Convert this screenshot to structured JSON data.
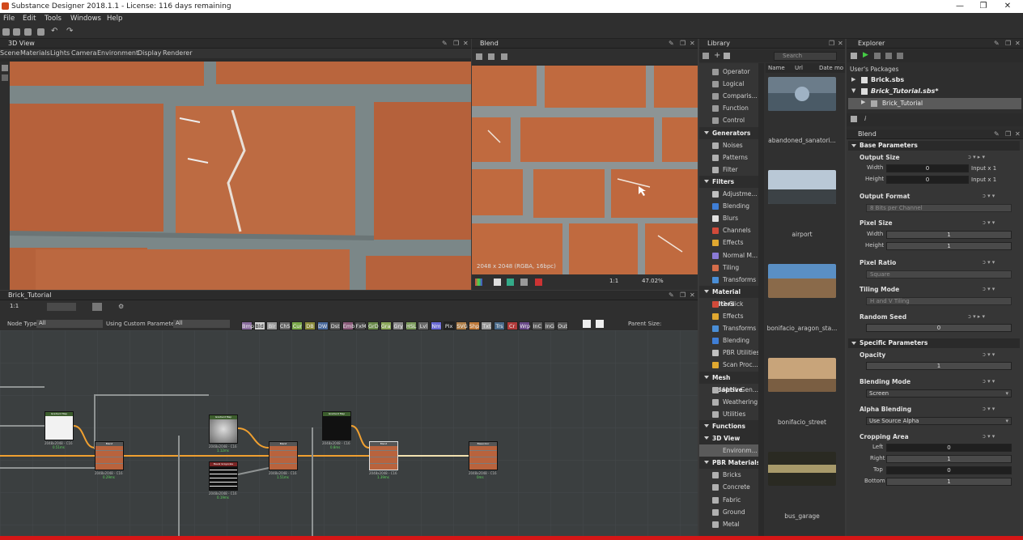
{
  "window": {
    "title": "Substance Designer 2018.1.1 - License: 116 days remaining",
    "min": "—",
    "max": "❐",
    "close": "✕"
  },
  "menu": [
    "File",
    "Edit",
    "Tools",
    "Windows",
    "Help"
  ],
  "view3d": {
    "title": "3D View",
    "menu": [
      "Scene",
      "Materials",
      "Lights",
      "Camera",
      "Environment",
      "Display",
      "Renderer"
    ]
  },
  "view2d": {
    "title": "Blend",
    "overlay": "2048 x 2048 (RGBA, 16bpc)",
    "ratio": "1:1",
    "zoom": "47.02%"
  },
  "library": {
    "title": "Library",
    "search_placeholder": "Search",
    "columns": [
      "Name",
      "Url",
      "Date mo"
    ],
    "items": [
      {
        "type": "item",
        "label": "Operator",
        "color": "#9a9a9a"
      },
      {
        "type": "item",
        "label": "Logical",
        "color": "#9a9a9a"
      },
      {
        "type": "item",
        "label": "Comparis...",
        "color": "#9a9a9a"
      },
      {
        "type": "item",
        "label": "Function",
        "color": "#9a9a9a"
      },
      {
        "type": "item",
        "label": "Control",
        "color": "#9a9a9a"
      },
      {
        "type": "cat",
        "label": "Generators"
      },
      {
        "type": "item",
        "label": "Noises",
        "color": "#b0b0b0"
      },
      {
        "type": "item",
        "label": "Patterns",
        "color": "#b0b0b0"
      },
      {
        "type": "item",
        "label": "Filter",
        "color": "#b0b0b0"
      },
      {
        "type": "cat",
        "label": "Filters"
      },
      {
        "type": "item",
        "label": "Adjustme...",
        "color": "#c0c0c0"
      },
      {
        "type": "item",
        "label": "Blending",
        "color": "#3f7ed6"
      },
      {
        "type": "item",
        "label": "Blurs",
        "color": "#e0e0e0"
      },
      {
        "type": "item",
        "label": "Channels",
        "color": "#d14a3a"
      },
      {
        "type": "item",
        "label": "Effects",
        "color": "#e0a830"
      },
      {
        "type": "item",
        "label": "Normal M...",
        "color": "#8a7ad6"
      },
      {
        "type": "item",
        "label": "Tiling",
        "color": "#d46d4a"
      },
      {
        "type": "item",
        "label": "Transforms",
        "color": "#4a8ed6"
      },
      {
        "type": "cat",
        "label": "Material Filters"
      },
      {
        "type": "item",
        "label": "1-Click",
        "color": "#d14a3a"
      },
      {
        "type": "item",
        "label": "Effects",
        "color": "#e0a830"
      },
      {
        "type": "item",
        "label": "Transforms",
        "color": "#4a8ed6"
      },
      {
        "type": "item",
        "label": "Blending",
        "color": "#3f7ed6"
      },
      {
        "type": "item",
        "label": "PBR Utilities",
        "color": "#c0c0c0"
      },
      {
        "type": "item",
        "label": "Scan Proc...",
        "color": "#e0a830"
      },
      {
        "type": "cat",
        "label": "Mesh Adaptive"
      },
      {
        "type": "item",
        "label": "Mask Gen...",
        "color": "#b0b0b0"
      },
      {
        "type": "item",
        "label": "Weathering",
        "color": "#b0b0b0"
      },
      {
        "type": "item",
        "label": "Utilities",
        "color": "#b0b0b0"
      },
      {
        "type": "cat",
        "label": "Functions"
      },
      {
        "type": "cat",
        "label": "3D View"
      },
      {
        "type": "sel",
        "label": "Environm..."
      },
      {
        "type": "cat",
        "label": "PBR Materials"
      },
      {
        "type": "item",
        "label": "Bricks",
        "color": "#b0b0b0"
      },
      {
        "type": "item",
        "label": "Concrete",
        "color": "#b0b0b0"
      },
      {
        "type": "item",
        "label": "Fabric",
        "color": "#b0b0b0"
      },
      {
        "type": "item",
        "label": "Ground",
        "color": "#b0b0b0"
      },
      {
        "type": "item",
        "label": "Metal",
        "color": "#b0b0b0"
      }
    ],
    "thumbs": [
      "abandoned_sanatori...",
      "airport",
      "bonifacio_aragon_sta...",
      "bonifacio_street",
      "bus_garage"
    ]
  },
  "explorer": {
    "title": "Explorer",
    "user_packages": "User's Packages",
    "packages": [
      "Brick.sbs",
      "Brick_Tutorial.sbs*"
    ],
    "graph": "Brick_Tutorial"
  },
  "graph": {
    "title": "Brick_Tutorial",
    "ratio": "1:1",
    "node_type_label": "Node Type",
    "node_type_value": "All",
    "custom_params_label": "Using Custom Parameters",
    "custom_params_value": "All",
    "parent_size_label": "Parent Size:",
    "chips": [
      {
        "label": "Bmp",
        "color": "#8a6d9e"
      },
      {
        "label": "Bld",
        "color": "#cfcfcf"
      },
      {
        "label": "Blr",
        "color": "#9a9a9a"
      },
      {
        "label": "ChS",
        "color": "#6a6a6a"
      },
      {
        "label": "Cur",
        "color": "#7aa84a"
      },
      {
        "label": "DB",
        "color": "#8a8a3a"
      },
      {
        "label": "DW",
        "color": "#4a6a9e"
      },
      {
        "label": "Dst",
        "color": "#5a5a5a"
      },
      {
        "label": "Emb",
        "color": "#8a5a7a"
      },
      {
        "label": "FxM",
        "color": "#4a4a4a"
      },
      {
        "label": "GrD",
        "color": "#6a8a4a"
      },
      {
        "label": "Gra",
        "color": "#8aa85a"
      },
      {
        "label": "Gry",
        "color": "#8a8a8a"
      },
      {
        "label": "HSL",
        "color": "#7a9a5a"
      },
      {
        "label": "Lvl",
        "color": "#6a6a6a"
      },
      {
        "label": "Nm",
        "color": "#6a6ad6"
      },
      {
        "label": "Pix",
        "color": "#222222"
      },
      {
        "label": "SVG",
        "color": "#b0804a"
      },
      {
        "label": "Shp",
        "color": "#c07a3a"
      },
      {
        "label": "Txt",
        "color": "#9a9a9a"
      },
      {
        "label": "Trs",
        "color": "#4a6a8a"
      },
      {
        "label": "Cr",
        "color": "#b03a3a"
      },
      {
        "label": "Wrp",
        "color": "#6a4a8a"
      },
      {
        "label": "InC",
        "color": "#5a5a5a"
      },
      {
        "label": "InG",
        "color": "#5a5a5a"
      },
      {
        "label": "Out",
        "color": "#5a5a5a"
      }
    ],
    "nodes": [
      {
        "title": "Gradient Map",
        "res": "2048x2048 - C16",
        "time": "0.51ms",
        "kind": "white",
        "header": "#3d5e2e"
      },
      {
        "title": "Blend",
        "res": "2048x2048 - C16",
        "time": "0.29ms",
        "kind": "brick",
        "header": "#555"
      },
      {
        "title": "Gradient Map",
        "res": "2048x2048 - C16",
        "time": "1.12ms",
        "kind": "noise",
        "header": "#3d5e2e"
      },
      {
        "title": "Bevel Grayscale",
        "res": "2048x2048 - C16",
        "time": "0.19ms",
        "kind": "mortar",
        "header": "#7a2525"
      },
      {
        "title": "Blend",
        "res": "2048x2048 - C16",
        "time": "1.51ms",
        "kind": "brick",
        "header": "#555"
      },
      {
        "title": "Gradient Map",
        "res": "2048x2048 - C16",
        "time": "0.8ms",
        "kind": "dark",
        "header": "#3d5e2e"
      },
      {
        "title": "Blend",
        "res": "2048x2048 - C16",
        "time": "1.39ms",
        "kind": "brick",
        "header": "#555"
      },
      {
        "title": "Basecolor",
        "res": "2048x2048 - C16",
        "time": "0ms",
        "kind": "brick",
        "header": "#555"
      }
    ]
  },
  "props": {
    "title": "Blend",
    "base": "Base Parameters",
    "output_size": "Output Size",
    "width_label": "Width",
    "height_label": "Height",
    "width_value": "0",
    "height_value": "0",
    "input_x1": "Input x 1",
    "output_format": "Output Format",
    "output_format_value": "8 Bits per Channel",
    "pixel_size": "Pixel Size",
    "pixel_width": "1",
    "pixel_height": "1",
    "pixel_ratio": "Pixel Ratio",
    "pixel_ratio_value": "Square",
    "tiling_mode": "Tiling Mode",
    "tiling_value": "H and V Tiling",
    "random_seed": "Random Seed",
    "random_seed_value": "0",
    "specific": "Specific Parameters",
    "opacity": "Opacity",
    "opacity_value": "1",
    "blending_mode": "Blending Mode",
    "blending_mode_value": "Screen",
    "alpha_blending": "Alpha Blending",
    "alpha_blending_value": "Use Source Alpha",
    "cropping_area": "Cropping Area",
    "crop_left_label": "Left",
    "crop_right_label": "Right",
    "crop_top_label": "Top",
    "crop_bottom_label": "Bottom",
    "crop_left": "0",
    "crop_right": "1",
    "crop_top": "0",
    "crop_bottom": "1"
  }
}
